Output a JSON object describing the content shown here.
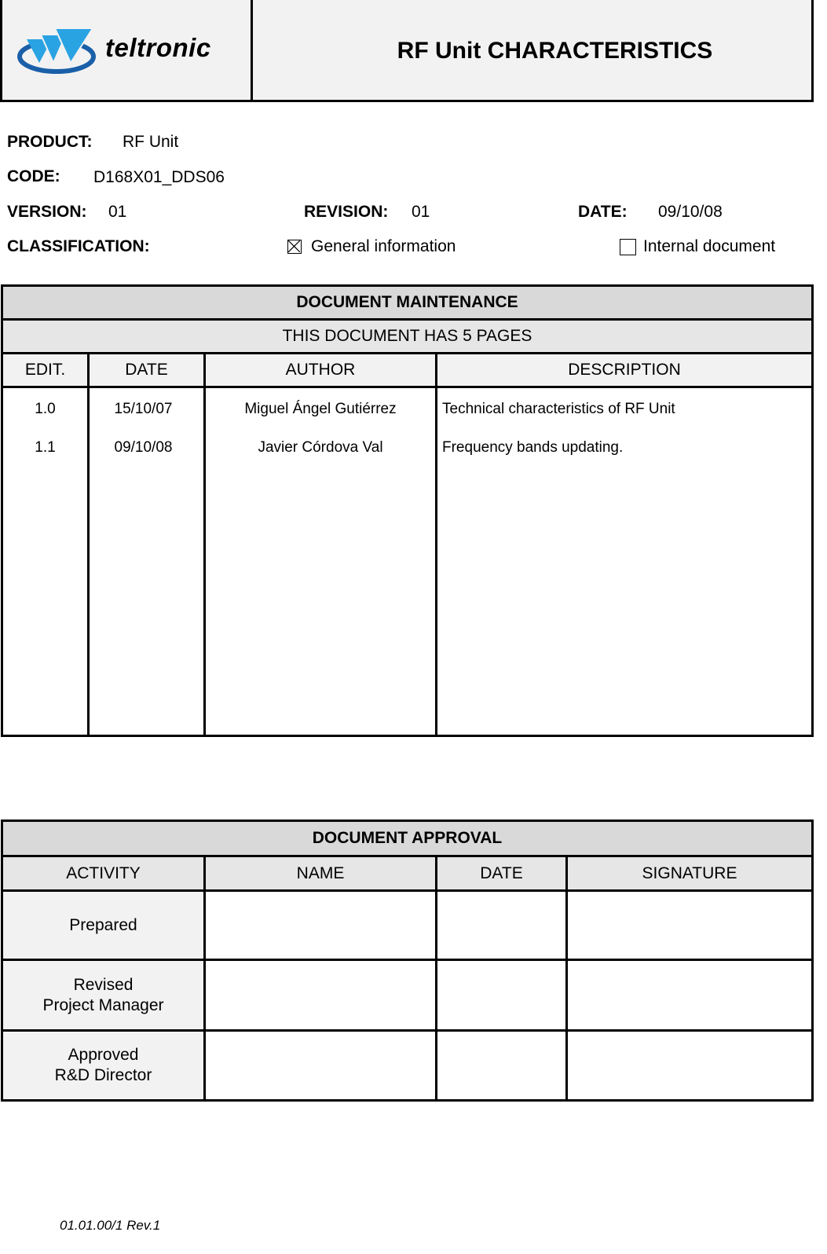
{
  "header": {
    "logo_text": "teltronic",
    "title": "RF Unit CHARACTERISTICS",
    "brand_color": "#1f9ee0"
  },
  "meta": {
    "product_label": "PRODUCT:",
    "product_value": "RF Unit",
    "code_label": "CODE:",
    "code_value": "D168X01_DDS06",
    "version_label": "VERSION:",
    "version_value": "01",
    "revision_label": "REVISION:",
    "revision_value": "01",
    "date_label": "DATE:",
    "date_value": "09/10/08",
    "classification_label": "CLASSIFICATION:",
    "classification_options": [
      {
        "label": "General information",
        "checked": true
      },
      {
        "label": "Internal document",
        "checked": false
      }
    ]
  },
  "maintenance": {
    "title": "DOCUMENT MAINTENANCE",
    "pages_note": "THIS DOCUMENT HAS 5 PAGES",
    "columns": [
      "EDIT.",
      "DATE",
      "AUTHOR",
      "DESCRIPTION"
    ],
    "rows": [
      {
        "edit": "1.0",
        "date": "15/10/07",
        "author": "Miguel Ángel Gutiérrez",
        "description": "Technical characteristics of RF Unit"
      },
      {
        "edit": "1.1",
        "date": "09/10/08",
        "author": "Javier Córdova Val",
        "description": "Frequency bands updating."
      }
    ]
  },
  "approval": {
    "title": "DOCUMENT APPROVAL",
    "columns": [
      "ACTIVITY",
      "NAME",
      "DATE",
      "SIGNATURE"
    ],
    "rows": [
      {
        "activity_line1": "Prepared",
        "activity_line2": "",
        "name": "",
        "date": "",
        "signature": ""
      },
      {
        "activity_line1": "Revised",
        "activity_line2": "Project Manager",
        "name": "",
        "date": "",
        "signature": ""
      },
      {
        "activity_line1": "Approved",
        "activity_line2": "R&D Director",
        "name": "",
        "date": "",
        "signature": ""
      }
    ]
  },
  "footer": {
    "form_code": "01.01.00/1 Rev.1"
  }
}
